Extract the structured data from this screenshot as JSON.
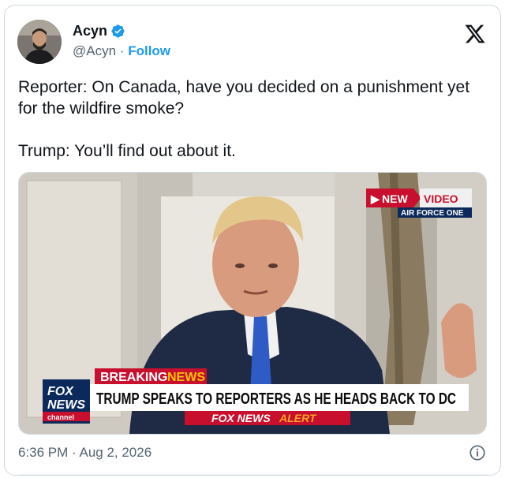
{
  "author": {
    "name": "Acyn",
    "handle": "@Acyn",
    "separator": "·",
    "follow_label": "Follow"
  },
  "tweet": {
    "text": "Reporter: On Canada, have you decided on a punishment yet for the wildfire smoke?\n\nTrump: You’ll find out about it."
  },
  "video": {
    "badge_new": "NEW",
    "badge_video": "VIDEO",
    "badge_sub": "AIR FORCE ONE",
    "breaking_label_1": "BREAKING",
    "breaking_label_2": "NEWS",
    "headline": "TRUMP SPEAKS TO REPORTERS AS HE HEADS BACK TO DC",
    "alert_1": "FOX NEWS",
    "alert_2": "ALERT",
    "logo_line1": "FOX",
    "logo_line2": "NEWS",
    "logo_line3": "channel"
  },
  "footer": {
    "timestamp": "6:36 PM · Aug 2, 2026"
  },
  "colors": {
    "link_blue": "#1d9bf0",
    "muted_gray": "#536471",
    "fox_red": "#c8102e",
    "fox_navy": "#0b2a5b",
    "alert_orange": "#f5a623"
  },
  "icons": [
    "verified-badge-icon",
    "x-logo-icon",
    "info-icon"
  ]
}
